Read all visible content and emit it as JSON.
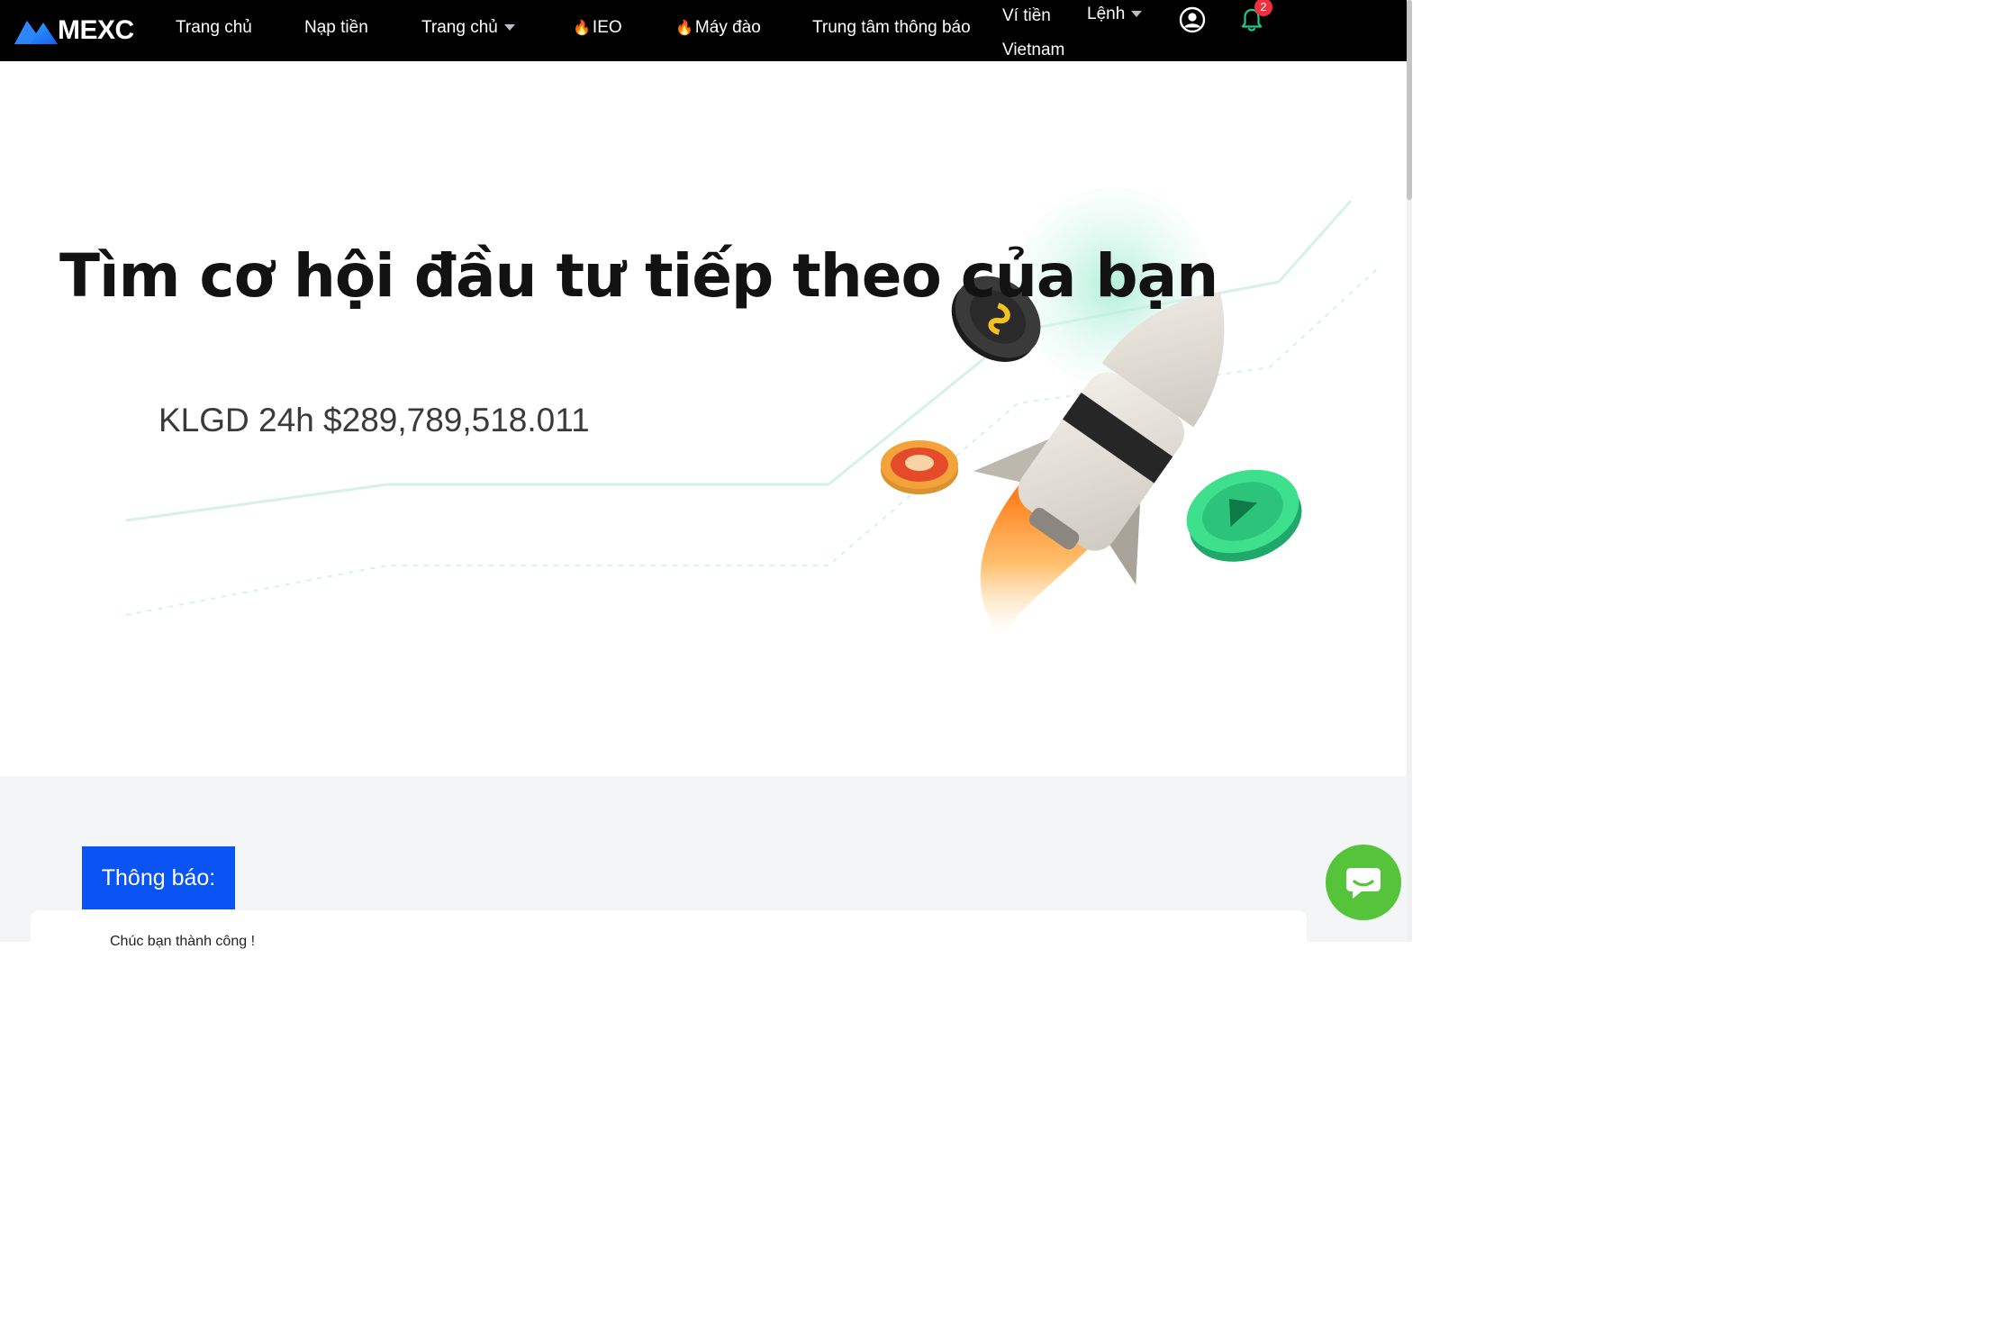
{
  "brand": {
    "name": "MEXC"
  },
  "nav": {
    "home": "Trang chủ",
    "deposit": "Nạp tiền",
    "home_menu": "Trang chủ",
    "ieo": "IEO",
    "mining": "Máy đào",
    "notification_center": "Trung tâm thông báo",
    "wallet": "Ví tiền",
    "region": "Vietnam",
    "orders": "Lệnh",
    "notification_count": "2"
  },
  "hero": {
    "title": "Tìm cơ hội đầu tư tiếp theo của bạn",
    "volume": "KLGD 24h $289,789,518.011"
  },
  "notice": {
    "tab_label": "Thông báo:",
    "message": "Chúc bạn thành công !"
  },
  "colors": {
    "navbar_bg": "#000000",
    "notice_tab": "#0a54f5",
    "chat_button": "#55c43a",
    "badge": "#f0303d"
  }
}
